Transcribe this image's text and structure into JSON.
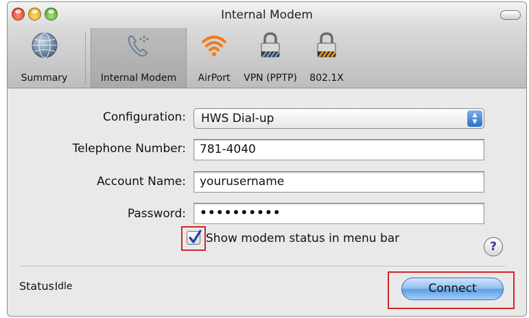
{
  "window": {
    "title": "Internal Modem"
  },
  "toolbar": {
    "items": [
      {
        "label": "Summary",
        "icon": "globe-icon"
      },
      {
        "label": "Internal Modem",
        "icon": "modem-phone-icon",
        "selected": true
      },
      {
        "label": "AirPort",
        "icon": "airport-wifi-icon"
      },
      {
        "label": "VPN (PPTP)",
        "icon": "lock-icon"
      },
      {
        "label": "802.1X",
        "icon": "lock-icon"
      }
    ]
  },
  "form": {
    "configuration_label": "Configuration:",
    "configuration_value": "HWS Dial-up",
    "telephone_label": "Telephone Number:",
    "telephone_value": "781-4040",
    "account_label": "Account Name:",
    "account_value": "yourusername",
    "password_label": "Password:",
    "password_value": "••••••••••",
    "show_status_label": "Show modem status in menu bar",
    "show_status_checked": true
  },
  "help": {
    "label": "?"
  },
  "status": {
    "label": "Status:",
    "value": "Idle"
  },
  "connect_button": {
    "label": "Connect"
  },
  "colors": {
    "highlight": "#d2222a",
    "button_blue": "#5e9be0",
    "window_bg": "#e9e9e9"
  }
}
